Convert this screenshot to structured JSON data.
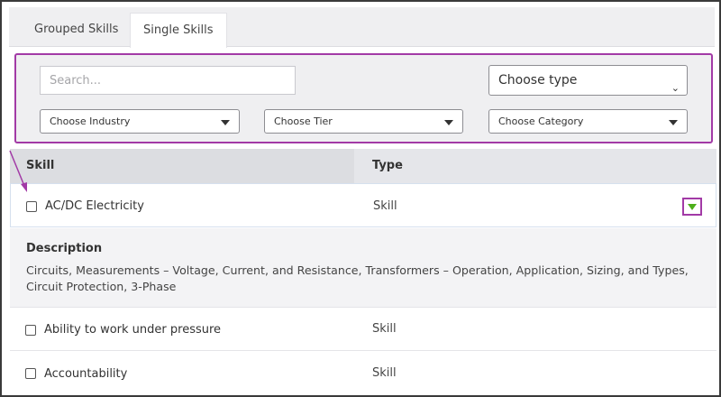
{
  "tabs": [
    {
      "label": "Grouped Skills",
      "active": false
    },
    {
      "label": "Single Skills",
      "active": true
    }
  ],
  "filters": {
    "search_placeholder": "Search...",
    "type_select": "Choose type",
    "industry_select": "Choose Industry",
    "tier_select": "Choose Tier",
    "category_select": "Choose Category",
    "highlight_color": "#a23aa6"
  },
  "table": {
    "headers": {
      "skill": "Skill",
      "type": "Type"
    },
    "rows": [
      {
        "name": "AC/DC Electricity",
        "type": "Skill",
        "expanded": true
      },
      {
        "name": "Ability to work under pressure",
        "type": "Skill",
        "expanded": false
      },
      {
        "name": "Accountability",
        "type": "Skill",
        "expanded": false
      }
    ],
    "description": {
      "title": "Description",
      "text": "Circuits, Measurements – Voltage, Current, and Resistance, Transformers – Operation, Application, Sizing, and Types, Circuit Protection, 3-Phase"
    },
    "expand_icon_color": "#4caf1a"
  }
}
